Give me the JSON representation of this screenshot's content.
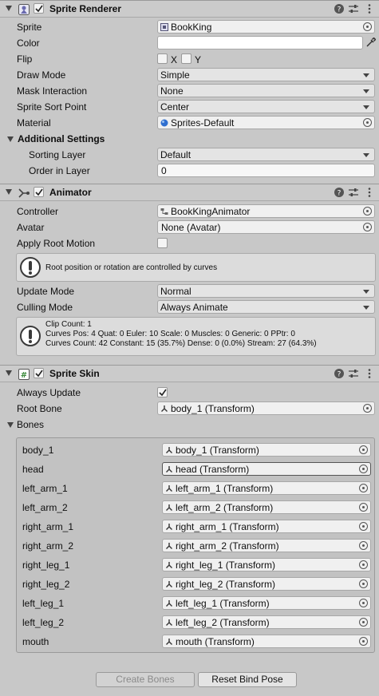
{
  "sprite_renderer": {
    "title": "Sprite Renderer",
    "enabled": true,
    "rows": {
      "sprite": {
        "label": "Sprite",
        "value": "BookKing",
        "icon": "sprite-icon"
      },
      "color": {
        "label": "Color",
        "value": "#ffffff"
      },
      "flip": {
        "label": "Flip",
        "x": "X",
        "y": "Y",
        "x_checked": false,
        "y_checked": false
      },
      "draw_mode": {
        "label": "Draw Mode",
        "value": "Simple"
      },
      "mask_interaction": {
        "label": "Mask Interaction",
        "value": "None"
      },
      "sort_point": {
        "label": "Sprite Sort Point",
        "value": "Center"
      },
      "material": {
        "label": "Material",
        "value": "Sprites-Default",
        "icon": "material-sphere-icon"
      }
    },
    "additional": {
      "title": "Additional Settings",
      "sorting_layer": {
        "label": "Sorting Layer",
        "value": "Default"
      },
      "order_in_layer": {
        "label": "Order in Layer",
        "value": "0"
      }
    }
  },
  "animator": {
    "title": "Animator",
    "enabled": true,
    "controller": {
      "label": "Controller",
      "value": "BookKingAnimator",
      "icon": "animator-controller-icon"
    },
    "avatar": {
      "label": "Avatar",
      "value": "None (Avatar)"
    },
    "apply_root_motion": {
      "label": "Apply Root Motion",
      "checked": false
    },
    "root_help": "Root position or rotation are controlled by curves",
    "update_mode": {
      "label": "Update Mode",
      "value": "Normal"
    },
    "culling_mode": {
      "label": "Culling Mode",
      "value": "Always Animate"
    },
    "clip_info": [
      "Clip Count: 1",
      "Curves Pos: 4 Quat: 0 Euler: 10 Scale: 0 Muscles: 0 Generic: 0 PPtr: 0",
      "Curves Count: 42 Constant: 15 (35.7%) Dense: 0 (0.0%) Stream: 27 (64.3%)"
    ]
  },
  "sprite_skin": {
    "title": "Sprite Skin",
    "enabled": true,
    "always_update": {
      "label": "Always Update",
      "checked": true
    },
    "root_bone": {
      "label": "Root Bone",
      "value": "body_1 (Transform)"
    },
    "bones_label": "Bones",
    "bones": [
      {
        "name": "body_1",
        "value": "body_1 (Transform)"
      },
      {
        "name": "head",
        "value": "head (Transform)"
      },
      {
        "name": "left_arm_1",
        "value": "left_arm_1 (Transform)"
      },
      {
        "name": "left_arm_2",
        "value": "left_arm_2 (Transform)"
      },
      {
        "name": "right_arm_1",
        "value": "right_arm_1 (Transform)"
      },
      {
        "name": "right_arm_2",
        "value": "right_arm_2 (Transform)"
      },
      {
        "name": "right_leg_1",
        "value": "right_leg_1 (Transform)"
      },
      {
        "name": "right_leg_2",
        "value": "right_leg_2 (Transform)"
      },
      {
        "name": "left_leg_1",
        "value": "left_leg_1 (Transform)"
      },
      {
        "name": "left_leg_2",
        "value": "left_leg_2 (Transform)"
      },
      {
        "name": "mouth",
        "value": "mouth (Transform)"
      }
    ],
    "create_bones": "Create Bones",
    "reset_bind_pose": "Reset Bind Pose"
  }
}
